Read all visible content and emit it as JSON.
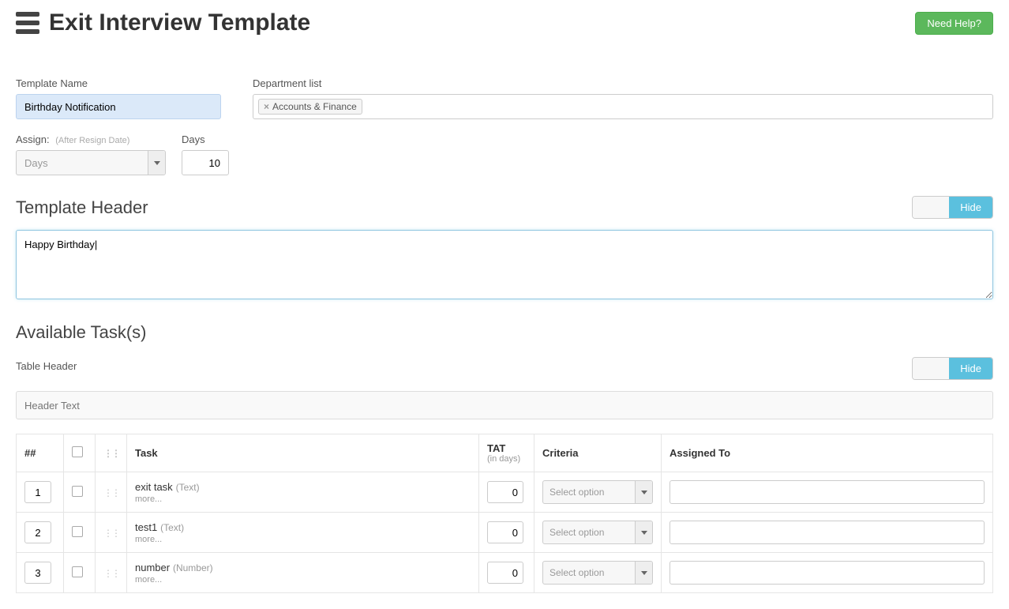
{
  "header": {
    "title": "Exit Interview Template",
    "help_button": "Need Help?"
  },
  "form": {
    "template_name_label": "Template Name",
    "template_name_value": "Birthday Notification",
    "department_list_label": "Department list",
    "department_tag": "Accounts & Finance",
    "assign_label": "Assign:",
    "assign_hint": "(After Resign Date)",
    "assign_select_value": "Days",
    "days_label": "Days",
    "days_value": "10"
  },
  "template_header": {
    "title": "Template Header",
    "toggle_hide": "Hide",
    "textarea_value": "Happy Birthday|"
  },
  "available_tasks": {
    "title": "Available Task(s)",
    "table_header_label": "Table Header",
    "table_header_placeholder": "Header Text",
    "toggle_hide": "Hide"
  },
  "table": {
    "columns": {
      "num": "##",
      "task": "Task",
      "tat": "TAT",
      "tat_sub": "(in days)",
      "criteria": "Criteria",
      "assigned": "Assigned To"
    },
    "criteria_placeholder": "Select option",
    "more_label": "more...",
    "rows": [
      {
        "n": "1",
        "name": "exit task",
        "type": "(Text)",
        "tat": "0"
      },
      {
        "n": "2",
        "name": "test1",
        "type": "(Text)",
        "tat": "0"
      },
      {
        "n": "3",
        "name": "number",
        "type": "(Number)",
        "tat": "0"
      }
    ]
  }
}
